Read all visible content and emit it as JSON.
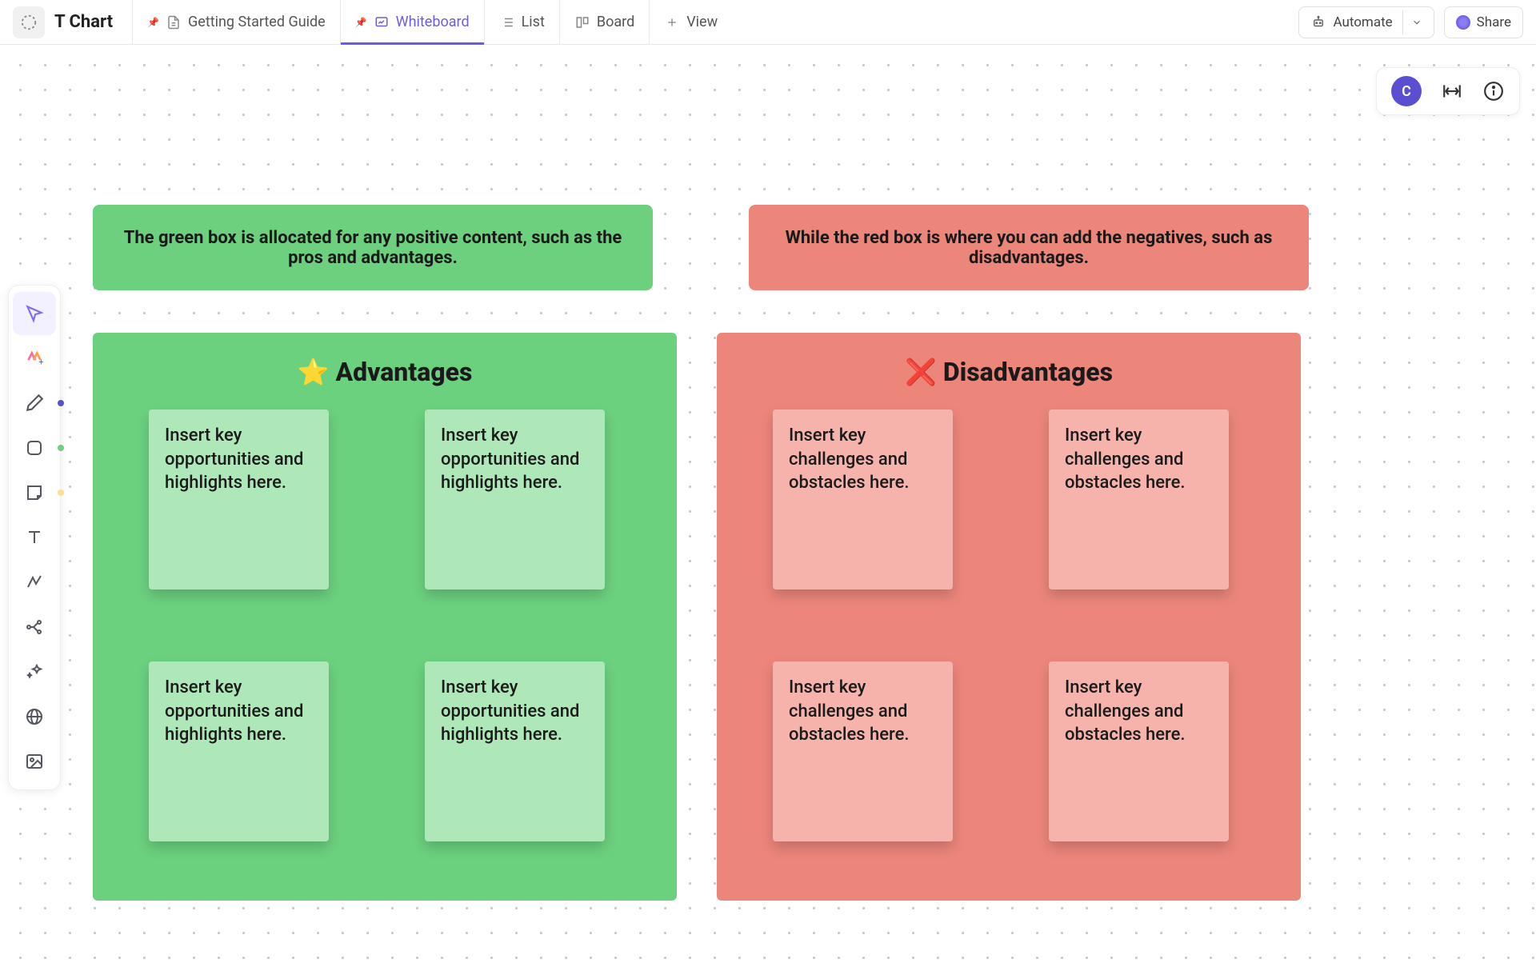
{
  "header": {
    "title": "T Chart",
    "views": [
      {
        "label": "Getting Started Guide",
        "pinned": true
      },
      {
        "label": "Whiteboard",
        "pinned": true,
        "active": true
      },
      {
        "label": "List"
      },
      {
        "label": "Board"
      },
      {
        "label": "View"
      }
    ],
    "automate_label": "Automate",
    "share_label": "Share"
  },
  "canvas_controls": {
    "avatar_initial": "C"
  },
  "tool_panel": {
    "tools": [
      {
        "name": "select",
        "active": true
      },
      {
        "name": "ai"
      },
      {
        "name": "pen",
        "dot": "#5b4fd1"
      },
      {
        "name": "shape",
        "dot": "#6dd07f"
      },
      {
        "name": "sticky",
        "dot": "#ffe08a"
      },
      {
        "name": "text"
      },
      {
        "name": "connector"
      },
      {
        "name": "mindmap"
      },
      {
        "name": "magic"
      },
      {
        "name": "web"
      },
      {
        "name": "image"
      }
    ]
  },
  "board": {
    "green_header": "The green box is allocated for any positive content, such as the pros and advantages.",
    "red_header": "While the red box is where you can add the negatives, such as disadvantages.",
    "advantages": {
      "icon": "⭐",
      "title": "Advantages",
      "cards": [
        "Insert key opportunities and highlights here.",
        "Insert key opportunities and highlights here.",
        "Insert key opportunities and highlights here.",
        "Insert key opportunities and highlights here."
      ]
    },
    "disadvantages": {
      "icon": "❌",
      "title": "Disadvantages",
      "cards": [
        "Insert key challenges and obstacles here.",
        "Insert key challenges and obstacles here.",
        "Insert key challenges and obstacles here.",
        "Insert key challenges and obstacles here."
      ]
    }
  }
}
